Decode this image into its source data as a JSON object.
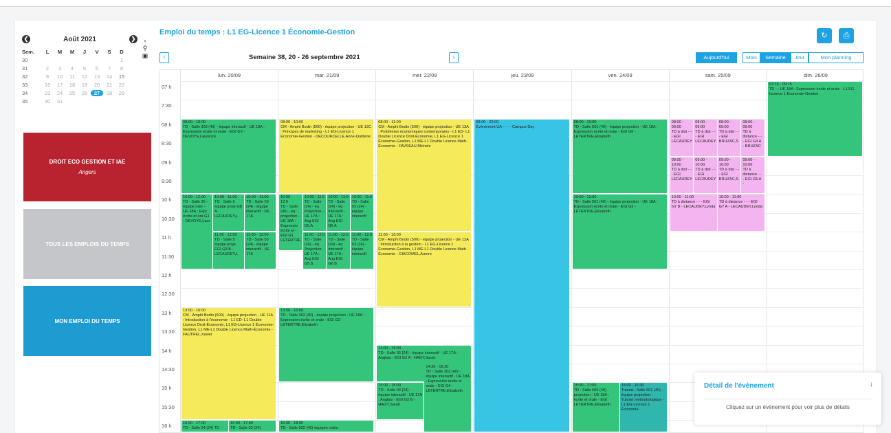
{
  "minical": {
    "month": "Août 2021",
    "prev": "❮",
    "next": "❯",
    "header": [
      "Sem.",
      "L",
      "M",
      "M",
      "J",
      "V",
      "S",
      "D"
    ],
    "weeks": [
      {
        "wk": "30",
        "days": [
          "",
          "",
          "",
          "",
          "",
          "",
          "1"
        ]
      },
      {
        "wk": "31",
        "days": [
          "2",
          "3",
          "4",
          "5",
          "6",
          "7",
          "8"
        ]
      },
      {
        "wk": "32",
        "days": [
          "9",
          "10",
          "11",
          "12",
          "13",
          "14",
          "15"
        ]
      },
      {
        "wk": "33",
        "days": [
          "16",
          "17",
          "18",
          "19",
          "20",
          "21",
          "22"
        ]
      },
      {
        "wk": "34",
        "days": [
          "23",
          "24",
          "25",
          "26",
          "27",
          "28",
          "29"
        ]
      },
      {
        "wk": "35",
        "days": [
          "30",
          "31",
          "",
          "",
          "",
          "",
          ""
        ]
      }
    ]
  },
  "side_tools": [
    "‹",
    "⚲",
    "▣"
  ],
  "tiles": {
    "red_title": "DROIT ECO GESTION ET IAE",
    "red_sub": "Angers",
    "grey_title": "TOUS LES EMPLOIS DU TEMPS",
    "blue_title": "MON EMPLOI DU TEMPS"
  },
  "header": {
    "title": "Emploi du temps : L1 EG-Licence 1 Économie-Gestion",
    "refresh_icon": "↻",
    "print_icon": "⎙",
    "prev": "‹",
    "next": "›",
    "week_label": "Semaine 38, 20 - 26 septembre 2021",
    "today": "Aujourd'hui",
    "views": [
      "Mois",
      "Semaine",
      "Jour",
      "Mon planning"
    ]
  },
  "days": [
    "lun. 20/09",
    "mar. 21/09",
    "mer. 22/09",
    "jeu. 23/09",
    "ven. 24/09",
    "sam. 25/09",
    "dim. 26/09"
  ],
  "slots": [
    "07 h",
    "7:30",
    "08 h",
    "8:30",
    "09 h",
    "9:30",
    "10 h",
    "10:30",
    "11 h",
    "11:30",
    "12 h",
    "12:30",
    "13 h",
    "13:30",
    "14 h",
    "14:30",
    "15 h",
    "15:30",
    "16 h"
  ],
  "events": [
    {
      "day": 0,
      "start": 8,
      "end": 10,
      "col": 0,
      "cols": 1,
      "color": "green",
      "time": "08:00 - 10:00",
      "text": "TD - Salle 303 (40) - équipe interactif - UE 18A : Expression écrite et orale - EGI G3 - DEVOYE,Laurence"
    },
    {
      "day": 0,
      "start": 10,
      "end": 12,
      "col": 0,
      "cols": 3,
      "color": "green",
      "time": "10:00 - 12:00",
      "text": "TD - Salle 30 - équipe inter - UE 18A : Expr écrite et ora G1 - DEVOYE,Laur"
    },
    {
      "day": 0,
      "start": 10,
      "end": 11,
      "col": 1,
      "cols": 3,
      "color": "green",
      "time": "10:00 - 11:00",
      "text": "TD - Salle 5 équipe proje G8 A - LECAUDEY,L"
    },
    {
      "day": 0,
      "start": 10,
      "end": 11,
      "col": 2,
      "cols": 3,
      "color": "green",
      "time": "10:00 - 11:00",
      "text": "TD - Salle 03 (24) - équipe interactif - UE 17A"
    },
    {
      "day": 0,
      "start": 11,
      "end": 12,
      "col": 1,
      "cols": 3,
      "color": "green",
      "time": "11:00 - 12:00",
      "text": "TD - Salle 5 équipe proje EGI G8 B - LECAUDEY,L"
    },
    {
      "day": 0,
      "start": 11,
      "end": 12,
      "col": 2,
      "cols": 3,
      "color": "green",
      "time": "11:00 - 12:00",
      "text": "TD - Salle 03 (24) - équipe interactif - UE 17A"
    },
    {
      "day": 0,
      "start": 13,
      "end": 16,
      "col": 0,
      "cols": 1,
      "color": "yellow",
      "time": "13:00 - 16:00",
      "text": "CM - Amphi Bodin (500) - équipe projection - UE 11A : Introduction à l'économie - L1 ED- L1 Double Licence Droit-Économie, L1 EG-Licence 1 Économie-Gestion, L1 ME-L1 Double Licence Math-Économie - FAUTREL,Xavier"
    },
    {
      "day": 0,
      "start": 16,
      "end": 17,
      "col": 0,
      "cols": 2,
      "color": "green",
      "time": "16:00 - 17:00",
      "text": "TD - Salle 04 (24) TD -"
    },
    {
      "day": 0,
      "start": 16,
      "end": 17,
      "col": 1,
      "cols": 2,
      "color": "green",
      "time": "16:00 - 17:00",
      "text": "TD - Salle 03 (24)"
    },
    {
      "day": 1,
      "start": 8,
      "end": 10,
      "col": 0,
      "cols": 1,
      "color": "yellow",
      "time": "08:00 - 10:00",
      "text": "CM - Amphi Bodin (500) - équipe projection - UE 12C : Principes de marketing - L1 EG-Licence 1 Économie-Gestion - DECOURCELLE,Anne-Quitterie"
    },
    {
      "day": 1,
      "start": 10,
      "end": 11.5,
      "col": 0,
      "cols": 4,
      "color": "green",
      "time": "10:00 - 12:0",
      "text": "TD - Salle (40) - éq projection - UE 18A : Expressio écrite et - EGI G1 LETERTRE"
    },
    {
      "day": 1,
      "start": 10,
      "end": 11,
      "col": 1,
      "cols": 4,
      "color": "green",
      "time": "10:00 - 11:0",
      "text": "TD - Salle (24) - éq Projection - UE 17A : Ang EGI G5 A"
    },
    {
      "day": 1,
      "start": 10,
      "end": 11,
      "col": 2,
      "cols": 4,
      "color": "green",
      "time": "10:00 - 11:0",
      "text": "TD - Salle (24) - éq Interactif - UE 17A : Ang EGI G6 A"
    },
    {
      "day": 1,
      "start": 10,
      "end": 11,
      "col": 3,
      "cols": 4,
      "color": "green",
      "time": "10:00 - 11:0",
      "text": "TD - Salle 03 (24) - équipe interactif"
    },
    {
      "day": 1,
      "start": 11,
      "end": 12,
      "col": 1,
      "cols": 4,
      "color": "green",
      "time": "11:00 - 12:0",
      "text": "TD - Salle (24) - éq Projection - UE 17A : Ang EGI G5 B"
    },
    {
      "day": 1,
      "start": 11,
      "end": 12,
      "col": 2,
      "cols": 4,
      "color": "green",
      "time": "11:00 - 12:0",
      "text": "TD - Salle (24) - éq Interactif - UE 17A : Ang EGI G6 B"
    },
    {
      "day": 1,
      "start": 11,
      "end": 12,
      "col": 3,
      "cols": 4,
      "color": "green",
      "time": "11:00 - 12:0",
      "text": "TD - Salle 03 (24) - équipe interactif"
    },
    {
      "day": 1,
      "start": 13,
      "end": 15,
      "col": 0,
      "cols": 1,
      "color": "green",
      "time": "13:00 - 15:00",
      "text": "TD - Salle 302 (40) - équipe projection - UE 18A : Expression écrite et orale - EGI G2 - LETERTRE,Elisabeth"
    },
    {
      "day": 1,
      "start": 16,
      "end": 17,
      "col": 0,
      "cols": 1,
      "color": "green",
      "time": "16:00 - 18:00",
      "text": "TD - Salle 502 (40) équipée vidéo -"
    },
    {
      "day": 2,
      "start": 8,
      "end": 11,
      "col": 0,
      "cols": 1,
      "color": "yellow",
      "time": "08:00 - 11:00",
      "text": "CM - Amphi Bodin (500) - équipe projection - UE 13A : Problèmes économiques contemporains - L1 ED- L1 Double Licence Droit-Économie, L1 EG-Licence 1 Économie-Gestion, L1 ME-L1 Double Licence Math-Économie - FAVREAU,Michele"
    },
    {
      "day": 2,
      "start": 11,
      "end": 13,
      "col": 0,
      "cols": 1,
      "color": "yellow",
      "time": "11:00 - 13:00",
      "text": "CM - Amphi Bodin (500) - équipe projection - UE 12A : Introduction à la gestion - L1 EG-Licence 1 Économie-Gestion, L1 ME-L1 Double Licence Math-Économie - GIACOMEL,Aurore"
    },
    {
      "day": 2,
      "start": 14,
      "end": 15,
      "col": 0,
      "cols": 1,
      "color": "green",
      "time": "14:00 - 15:00",
      "text": "TD - Salle 03 (24) - équipe interactif - UE 17A : Anglais - EGI G2 A - HAGY,Sarah"
    },
    {
      "day": 2,
      "start": 14.5,
      "end": 16.5,
      "col": 1,
      "cols": 2,
      "color": "green",
      "time": "14:30 - 16:30",
      "text": "TD - Salle 303 (40) - équipe interactif - UE 18A : Expression écrite et orale - EGI G4 - LETERTRE,Elisabeth"
    },
    {
      "day": 2,
      "start": 15,
      "end": 16,
      "col": 0,
      "cols": 2,
      "color": "green",
      "time": "15:00 - 16:00",
      "text": "TD - Salle 03 (24) - équipe interactif - UE 17A : Anglais - EGI G2 B - HAGY,Sarah"
    },
    {
      "day": 3,
      "start": 8,
      "end": 22,
      "col": 0,
      "cols": 1,
      "color": "cyan",
      "time": "08:00 - 22:00",
      "text": "Évènement UA - - - - Campus Day"
    },
    {
      "day": 4,
      "start": 8,
      "end": 10,
      "col": 0,
      "cols": 1,
      "color": "green",
      "time": "08:00 - 10:00",
      "text": "TD - Salle 501 (40) - équipe projection - UE 18A : Expression écrite et orale - EGI G6 - LETERTRE,Elisabeth"
    },
    {
      "day": 4,
      "start": 10,
      "end": 12,
      "col": 0,
      "cols": 1,
      "color": "green",
      "time": "10:00 - 12:00",
      "text": "TD - Salle 501 (40) - équipe projection - UE 18A : Expression écrite et orale - EGI G3 - LETERTRE,Elisabeth"
    },
    {
      "day": 4,
      "start": 15,
      "end": 17,
      "col": 0,
      "cols": 2,
      "color": "green",
      "time": "15:00 - 17:00",
      "text": "TD - Salle 505 (40) projection - UE 18A : écrite et orale - EGI LETERTRE,Elisabeth"
    },
    {
      "day": 4,
      "start": 15,
      "end": 16.5,
      "col": 1,
      "cols": 2,
      "color": "teal",
      "time": "15:00 - 16:30",
      "text": "Tutorat - Salle 501 (40) - équipe projection - Tutorat méthodologique - L1 EG-Licence 1 Économie-"
    },
    {
      "day": 5,
      "start": 8,
      "end": 9,
      "col": 0,
      "cols": 4,
      "color": "pink",
      "time": "08:00 - 09:00",
      "text": "TD à dist - - - EGI LECAUDEY"
    },
    {
      "day": 5,
      "start": 8,
      "end": 9,
      "col": 1,
      "cols": 4,
      "color": "pink",
      "time": "08:00 - 09:00",
      "text": "TD à dist - - - EGI LECAUDEY"
    },
    {
      "day": 5,
      "start": 8,
      "end": 9,
      "col": 2,
      "cols": 4,
      "color": "pink",
      "time": "08:00 - 09:00",
      "text": "TD à dist - - - EGI BRUZAC,S"
    },
    {
      "day": 5,
      "start": 8,
      "end": 9,
      "col": 3,
      "cols": 4,
      "color": "pink",
      "time": "08:00 - 09:00",
      "text": "TD à distance - - - EGI G4 A - BRUZAC"
    },
    {
      "day": 5,
      "start": 9,
      "end": 10,
      "col": 0,
      "cols": 4,
      "color": "pink",
      "time": "09:00 - 10:00",
      "text": "TD à dist - - - EGI LECAUDEY"
    },
    {
      "day": 5,
      "start": 9,
      "end": 10,
      "col": 1,
      "cols": 4,
      "color": "pink",
      "time": "09:00 - 10:00",
      "text": "TD à dist - - - EGI LECAUDEY"
    },
    {
      "day": 5,
      "start": 9,
      "end": 10,
      "col": 2,
      "cols": 4,
      "color": "pink",
      "time": "09:00 - 10:00",
      "text": "TD à dist - - - EGI BRUZAC,S"
    },
    {
      "day": 5,
      "start": 9,
      "end": 10,
      "col": 3,
      "cols": 4,
      "color": "pink",
      "time": "09:00 - 10:00",
      "text": "TD à distance - - - EGI G5 A -"
    },
    {
      "day": 5,
      "start": 10,
      "end": 11,
      "col": 0,
      "cols": 2,
      "color": "pink",
      "time": "10:00 - 11:00",
      "text": "TD à distance - - - EGI G7 B - LECAUDEY,Lynda"
    },
    {
      "day": 5,
      "start": 10,
      "end": 11,
      "col": 1,
      "cols": 2,
      "color": "pink",
      "time": "10:00 - 11:00",
      "text": "TD à distance - - - EGI G7 A - LECAUDEY,Lynda"
    },
    {
      "day": 6,
      "start": 7,
      "end": 9,
      "col": 0,
      "cols": 1,
      "color": "green",
      "time": "07:15 - 09:15",
      "text": "TD - - UE 18A : Expression écrite et orale - L1 EG-Licence 1 Économie-Gestion"
    }
  ],
  "detail": {
    "title": "Détail de l'évènement",
    "close_icon": "↓",
    "message": "Cliquez sur un évènement pour voir plus de détails"
  },
  "colors": {
    "accent": "#1da2e2",
    "red_tile": "#b8232f",
    "grey_tile": "#c4c6c9",
    "blue_tile": "#1e9bd1",
    "event_green": "#34c47a",
    "event_yellow": "#f5eb5a",
    "event_cyan": "#38c4e4",
    "event_pink": "#f4b4f0",
    "event_teal": "#2fb6ad"
  }
}
